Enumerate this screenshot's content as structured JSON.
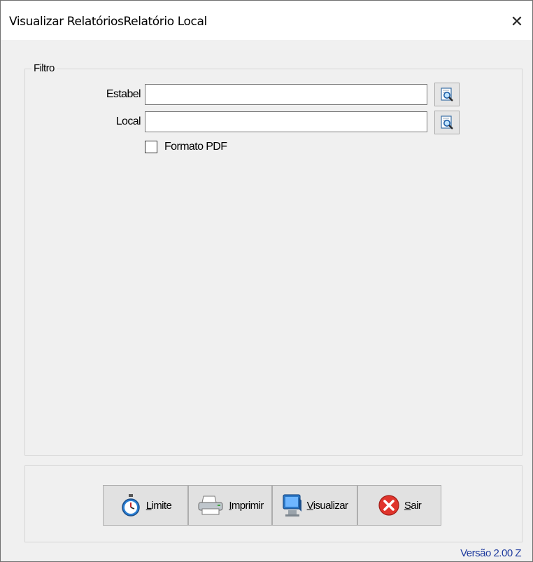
{
  "window": {
    "title": "Visualizar RelatóriosRelatório Local",
    "close_glyph": "✕"
  },
  "filter": {
    "legend": "Filtro",
    "estabel": {
      "label": "Estabel",
      "value": "",
      "icon": "lookup-icon"
    },
    "local": {
      "label": "Local",
      "value": "",
      "icon": "lookup-icon"
    },
    "pdf": {
      "label": "Formato PDF",
      "checked": false
    }
  },
  "buttons": [
    {
      "first": "L",
      "rest": "imite",
      "icon": "stopwatch-icon"
    },
    {
      "first": "I",
      "rest": "mprimir",
      "icon": "printer-icon"
    },
    {
      "first": "V",
      "rest": "isualizar",
      "icon": "monitor-icon"
    },
    {
      "first": "S",
      "rest": "air",
      "icon": "exit-icon"
    }
  ],
  "footer": {
    "version": "Versão 2.00 Z"
  },
  "colors": {
    "version_text": "#1e3a9e",
    "exit_red": "#e0342c"
  }
}
